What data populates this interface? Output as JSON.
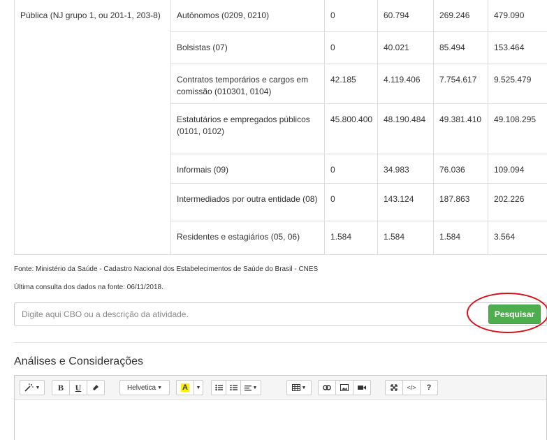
{
  "table": {
    "group_label": "Pública (NJ grupo 1, ou 201-1, 203-8)",
    "rows": [
      {
        "category": "Autônomos (0209, 0210)",
        "v1": "0",
        "v2": "60.794",
        "v3": "269.246",
        "v4": "479.090"
      },
      {
        "category": "Bolsistas (07)",
        "v1": "0",
        "v2": "40.021",
        "v3": "85.494",
        "v4": "153.464"
      },
      {
        "category": "Contratos temporários e cargos em comissão (010301, 0104)",
        "v1": "42.185",
        "v2": "4.119.406",
        "v3": "7.754.617",
        "v4": "9.525.479"
      },
      {
        "category": "Estatutários e empregados públicos (0101, 0102)",
        "v1": "45.800.400",
        "v2": "48.190.484",
        "v3": "49.381.410",
        "v4": "49.108.295"
      },
      {
        "category": "Informais (09)",
        "v1": "0",
        "v2": "34.983",
        "v3": "76.036",
        "v4": "109.094"
      },
      {
        "category": "Intermediados por outra entidade (08)",
        "v1": "0",
        "v2": "143.124",
        "v3": "187.863",
        "v4": "202.226"
      },
      {
        "category": "Residentes e estagiários (05, 06)",
        "v1": "1.584",
        "v2": "1.584",
        "v3": "1.584",
        "v4": "3.564"
      }
    ]
  },
  "source": {
    "line1": "Fonte: Ministério da Saúde - Cadastro Nacional dos Estabelecimentos de Saúde do Brasil - CNES",
    "line2": "Última consulta dos dados na fonte: 06/11/2018."
  },
  "search": {
    "placeholder": "Digite aqui CBO ou a descrição da atividade.",
    "button_label": "Pesquisar",
    "button_color": "#4cae4c",
    "highlight_color": "#d6101b"
  },
  "analysis": {
    "title": "Análises e Considerações"
  },
  "toolbar": {
    "bold": "B",
    "underline": "U",
    "font_family": "Helvetica",
    "highlight_letter": "A",
    "help": "?",
    "code": "</>",
    "icons": [
      "magic-icon",
      "bold-icon",
      "underline-icon",
      "eraser-icon",
      "font-family-select",
      "text-color-icon",
      "unordered-list-icon",
      "ordered-list-icon",
      "align-icon",
      "table-icon",
      "link-icon",
      "picture-icon",
      "video-icon",
      "fullscreen-icon",
      "code-view-icon",
      "help-icon"
    ]
  }
}
